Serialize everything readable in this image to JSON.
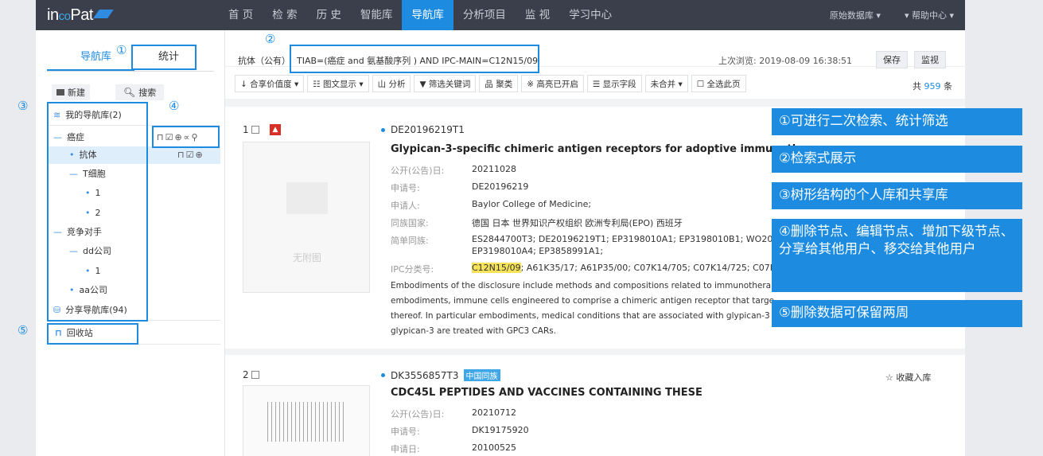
{
  "brand": {
    "pre": "in",
    "mid": "co",
    "post": "Pat"
  },
  "nav": {
    "items": [
      "首 页",
      "检 索",
      "历 史",
      "智能库",
      "导航库",
      "分析项目",
      "监 视",
      "学习中心"
    ],
    "active_index": 4,
    "right": [
      "原始数据库 ▾",
      "▾ 帮助中心 ▾"
    ]
  },
  "left": {
    "tabs": [
      "导航库",
      "统计"
    ],
    "new_btn": "新建",
    "search_btn": "搜索",
    "tree": [
      {
        "label": "我的导航库(2)",
        "level": 0
      },
      {
        "label": "癌症",
        "level": 1
      },
      {
        "label": "抗体",
        "level": 2
      },
      {
        "label": "T细胞",
        "level": 2
      },
      {
        "label": "1",
        "level": 3
      },
      {
        "label": "2",
        "level": 3
      },
      {
        "label": "竞争对手",
        "level": 1
      },
      {
        "label": "dd公司",
        "level": 2
      },
      {
        "label": "1",
        "level": 3
      },
      {
        "label": "aa公司",
        "level": 2
      },
      {
        "label": "分享导航库(94)",
        "level": 0
      },
      {
        "label": "回收站",
        "level": 0
      }
    ]
  },
  "query": {
    "label": "抗体（公有）",
    "text": "TIAB=(癌症 and 氨基酸序列 ) AND IPC-MAIN=C12N15/09",
    "last_view": "上次浏览: 2019-08-09 16:38:51",
    "save": "保存",
    "monitor": "监视"
  },
  "toolbar": [
    "↓ 合享价值度 ▾",
    "☷ 图文显示 ▾",
    "山 分析",
    "▼ 筛选关键词",
    "品 聚类",
    "※ 高亮已开启",
    "☰ 显示字段",
    "未合并          ▾",
    "☐ 全选此页"
  ],
  "total": {
    "prefix": "共",
    "count": "959",
    "suffix": "条"
  },
  "records": [
    {
      "num": "1",
      "pn": "DE20196219T1",
      "title": "Glypican-3-specific chimeric antigen receptors for adoptive immunothera",
      "noimg": "无附图",
      "fields": [
        {
          "label": "公开(公告)日:",
          "value": "20211028"
        },
        {
          "label": "申请号:",
          "value": "DE20196219"
        },
        {
          "label": "申请人:",
          "value": "Baylor College of Medicine;"
        },
        {
          "label": "同族国家:",
          "value": "德国 日本 世界知识产权组织 欧洲专利局(EPO) 西班牙"
        },
        {
          "label": "简单同族:",
          "value": "ES2844700T3; DE20196219T1; EP3198010A1; EP3198010B1; WO201604"
        },
        {
          "label": "",
          "value": "EP3198010A4; EP3858991A1;"
        },
        {
          "label": "IPC分类号:",
          "value": "; A61K35/17; A61P35/00; C07K14/705; C07K14/725; C07K16",
          "hl": "C12N15/09"
        }
      ],
      "abstract": [
        "Embodiments of the disclosure include methods and compositions related to immunothera",
        "embodiments, immune cells engineered to comprise a chimeric antigen receptor that targe",
        "thereof. In particular embodiments, medical conditions that are associated with glypican-3",
        "glypican-3 are treated with GPC3 CARs."
      ]
    },
    {
      "num": "2",
      "pn": "DK3556857T3",
      "badge": "中国同族",
      "fav": "☆ 收藏入库",
      "title": "CDC45L PEPTIDES AND VACCINES CONTAINING THESE",
      "fields": [
        {
          "label": "公开(公告)日:",
          "value": "20210712"
        },
        {
          "label": "申请号:",
          "value": "DK19175920"
        },
        {
          "label": "申请日:",
          "value": "20100525"
        }
      ]
    }
  ],
  "annotations": {
    "circles": [
      "①",
      "②",
      "③",
      "④",
      "⑤"
    ],
    "callouts": [
      "①可进行二次检索、统计筛选",
      "②检索式展示",
      "③树形结构的个人库和共享库",
      "④删除节点、编辑节点、增加下级节点、分享给其他用户、移交给其他用户",
      "⑤删除数据可保留两周"
    ]
  },
  "colors": {
    "accent": "#1d8ce0",
    "nav_bg": "#3a3f4b",
    "highlight": "#f6e35a"
  }
}
